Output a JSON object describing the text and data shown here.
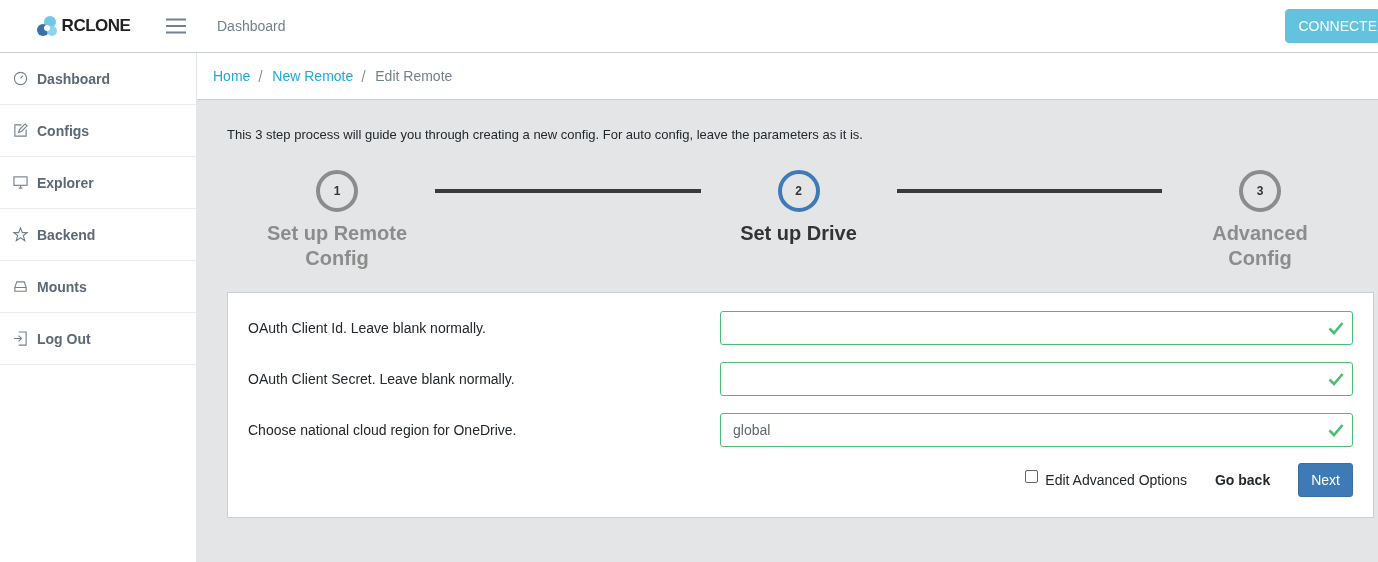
{
  "header": {
    "logo": "RCLONE",
    "title": "Dashboard",
    "connect_button": "CONNECTE"
  },
  "sidebar": {
    "items": [
      {
        "label": "Dashboard",
        "selected": false
      },
      {
        "label": "Configs",
        "selected": false
      },
      {
        "label": "Explorer",
        "selected": false
      },
      {
        "label": "Backend",
        "selected": false
      },
      {
        "label": "Mounts",
        "selected": false
      },
      {
        "label": "Log Out",
        "selected": false
      }
    ]
  },
  "breadcrumb": [
    "Home",
    "New Remote",
    "Edit Remote"
  ],
  "intro": "This 3 step process will guide you through creating a new config. For auto config, leave the parameters as it is.",
  "steps": [
    {
      "number": "1",
      "label": "Set up Remote Config",
      "selected": false
    },
    {
      "number": "2",
      "label": "Set up Drive",
      "selected": true
    },
    {
      "number": "3",
      "label": "Advanced Config",
      "selected": false
    }
  ],
  "fields": [
    {
      "label": "OAuth Client Id. Leave blank normally.",
      "valid": true
    },
    {
      "label": "OAuth Client Secret. Leave blank normally.",
      "valid": true
    },
    {
      "label": "Choose national cloud region for OneDrive.",
      "value": "global",
      "valid": true
    }
  ],
  "advanced_option": {
    "label": "Edit Advanced Options",
    "checked": false
  },
  "buttons": {
    "back": "Go back",
    "next": "Next"
  }
}
